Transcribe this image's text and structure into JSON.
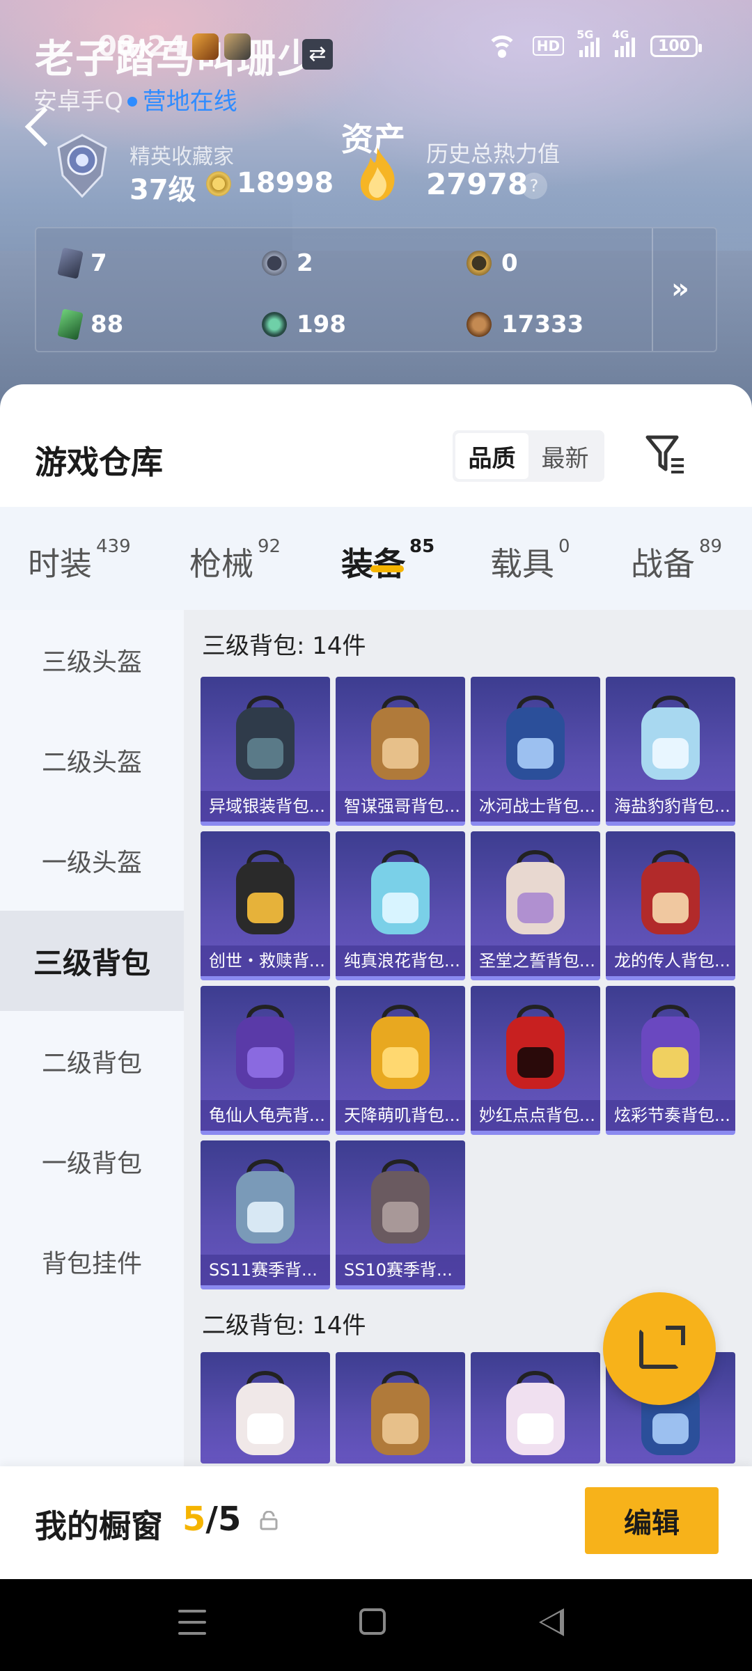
{
  "status_bar": {
    "time": "08:24",
    "battery": "100",
    "hd": "HD",
    "sig1": "5G",
    "sig2": "4G"
  },
  "profile": {
    "nickname": "老子踏马叫珊少",
    "platform": "安卓手Q",
    "status": "营地在线",
    "rank_title": "精英收藏家",
    "level": "37级",
    "coins": "18998",
    "assets_label": "资产",
    "heat_title": "历史总热力值",
    "heat_value": "27978",
    "help": "?"
  },
  "stats": [
    {
      "value": "7",
      "icon": "card-icon"
    },
    {
      "value": "2",
      "icon": "silver-coin-icon"
    },
    {
      "value": "0",
      "icon": "gold-coin-icon"
    },
    {
      "value": "88",
      "icon": "green-card-icon"
    },
    {
      "value": "198",
      "icon": "jade-coin-icon"
    },
    {
      "value": "17333",
      "icon": "bronze-coin-icon"
    }
  ],
  "stats_more": "»",
  "warehouse": {
    "title": "游戏仓库",
    "sort_options": [
      "品质",
      "最新"
    ],
    "sort_active": "品质"
  },
  "tabs": [
    {
      "label": "时装",
      "count": "439"
    },
    {
      "label": "枪械",
      "count": "92"
    },
    {
      "label": "装备",
      "count": "85"
    },
    {
      "label": "载具",
      "count": "0"
    },
    {
      "label": "战备",
      "count": "89"
    }
  ],
  "active_tab": "装备",
  "side_nav": [
    "三级头盔",
    "二级头盔",
    "一级头盔",
    "三级背包",
    "二级背包",
    "一级背包",
    "背包挂件"
  ],
  "side_active": "三级背包",
  "groups": [
    {
      "title": "三级背包: 14件",
      "items": [
        "异域银装背包...",
        "智谋强哥背包...",
        "冰河战士背包...",
        "海盐豹豹背包...",
        "创世・救赎背...",
        "纯真浪花背包...",
        "圣堂之誓背包...",
        "龙的传人背包...",
        "龟仙人龟壳背...",
        "天降萌叽背包...",
        "妙红点点背包...",
        "炫彩节奏背包...",
        "SS11赛季背...",
        "SS10赛季背..."
      ]
    },
    {
      "title": "二级背包: 14件",
      "items": [
        "",
        "",
        "",
        ""
      ]
    }
  ],
  "showcase": {
    "title": "我的橱窗",
    "current": "5",
    "total": "/5",
    "edit": "编辑"
  },
  "colors": {
    "accent": "#f5b400",
    "online": "#2f8cff",
    "card_bg": "#4a44a0"
  }
}
